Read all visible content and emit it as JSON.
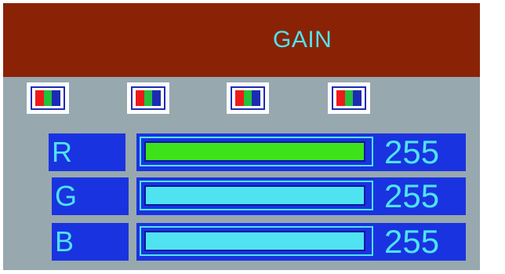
{
  "osd": {
    "title": "GAIN",
    "presets": [
      {
        "name": "color-preset-1-icon"
      },
      {
        "name": "color-preset-2-icon"
      },
      {
        "name": "color-preset-3-icon"
      },
      {
        "name": "color-preset-4-icon"
      }
    ],
    "channels": [
      {
        "label": "R",
        "value": "255",
        "level": 1.0,
        "fill_color": "#3ee21a"
      },
      {
        "label": "G",
        "value": "255",
        "level": 1.0,
        "fill_color": "#4fe3f2"
      },
      {
        "label": "B",
        "value": "255",
        "level": 1.0,
        "fill_color": "#4fe3f2"
      }
    ]
  },
  "colors": {
    "background": "#97a8af",
    "header": "#8a2306",
    "panel": "#1a33e0",
    "text": "#4fe3f2"
  }
}
